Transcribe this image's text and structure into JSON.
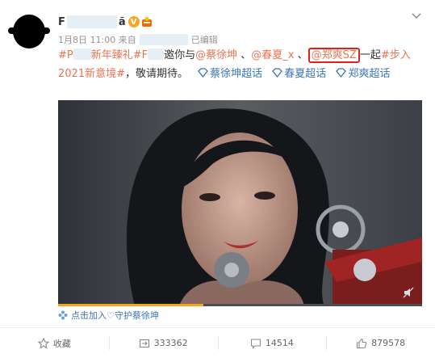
{
  "post": {
    "author_prefix": "F",
    "author_suffix": "ã",
    "time": "1月8日 11:00 来自",
    "edited": "已编辑",
    "text_tag_open": "#P",
    "text_tag_mid": "新年臻礼#F",
    "text_invite": "邀你与",
    "mention_1": "@蔡徐坤",
    "sep_1": "、",
    "mention_2": "@春夏_x",
    "sep_2": "、",
    "mention_3": "@郑爽SZ",
    "text_together": "一起",
    "topic": "#步入2021新意境#",
    "text_end": "，敬请期待。",
    "super_1": "蔡徐坤超话",
    "super_2": "春夏超话",
    "super_3": "郑爽超话",
    "video_progress": 0.4,
    "fan_action": "点击加入♡守护蔡徐坤"
  },
  "actions": {
    "favorite": "收藏",
    "repost": "333362",
    "comment": "14514",
    "like": "879578"
  },
  "colors": {
    "link_orange": "#eb7350",
    "link_blue": "#3b76b4",
    "highlight_red": "#e0201a",
    "progress": "#f8a41c"
  }
}
